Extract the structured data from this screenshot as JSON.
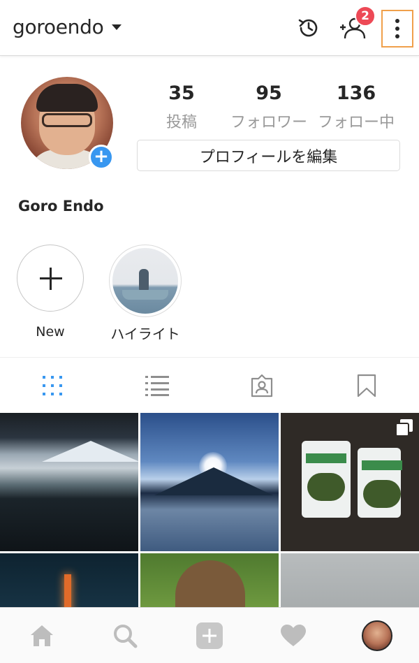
{
  "header": {
    "username": "goroendo",
    "notification_badge": "2",
    "badge_color": "#ed4956",
    "icons": [
      "chevron-down-icon",
      "history-icon",
      "discover-people-icon",
      "more-options-icon"
    ]
  },
  "profile": {
    "stats": [
      {
        "value": "35",
        "label": "投稿"
      },
      {
        "value": "95",
        "label": "フォロワー"
      },
      {
        "value": "136",
        "label": "フォロー中"
      }
    ],
    "edit_profile_label": "プロフィールを編集",
    "full_name": "Goro Endo",
    "accent_color": "#3897f0"
  },
  "highlights": [
    {
      "label": "New",
      "icon": "plus-icon"
    },
    {
      "label": "ハイライト",
      "icon": "highlight-thumbnail"
    }
  ],
  "tabs": [
    {
      "name": "grid-view",
      "icon": "grid-icon",
      "active": true
    },
    {
      "name": "list-view",
      "icon": "list-icon",
      "active": false
    },
    {
      "name": "tagged",
      "icon": "tagged-user-icon",
      "active": false
    },
    {
      "name": "saved",
      "icon": "bookmark-icon",
      "active": false
    }
  ],
  "grid": {
    "posts": [
      {
        "description": "mountain-lake-view"
      },
      {
        "description": "diamond-fuji-frozen-lake"
      },
      {
        "description": "mozuku-soup-packages",
        "multiple": true
      },
      {
        "description": "night-city-tower"
      },
      {
        "description": "prairie-dog-grass"
      },
      {
        "description": "indoor-room"
      }
    ]
  },
  "bottom_nav": {
    "items": [
      "home-icon",
      "search-icon",
      "add-post-icon",
      "activity-heart-icon",
      "profile-avatar"
    ]
  }
}
